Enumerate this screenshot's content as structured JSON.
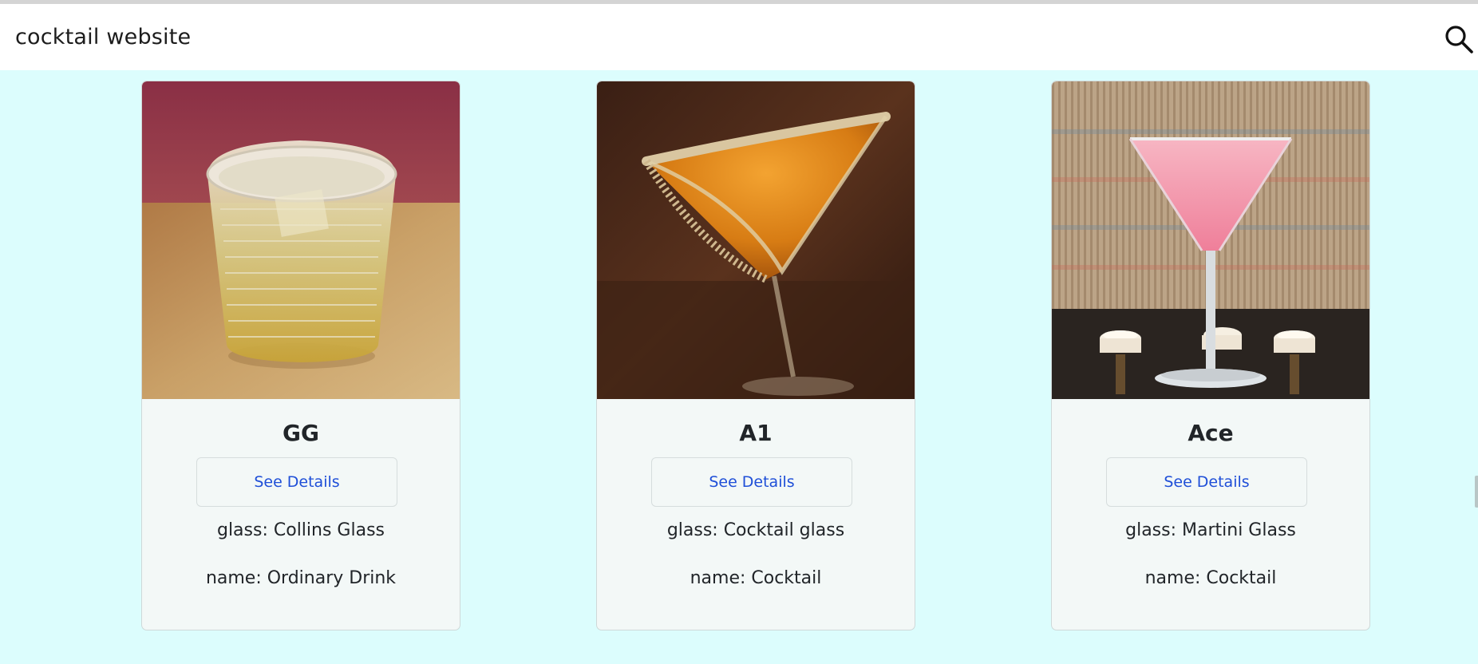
{
  "header": {
    "site_title": "cocktail website",
    "search_icon": "search-icon"
  },
  "colors": {
    "page_background": "#dcfdfd",
    "card_background": "#f3f8f7",
    "link_blue": "#1f4fd8"
  },
  "cards": [
    {
      "title": "GG",
      "button_label": "See Details",
      "glass": "glass: Collins Glass",
      "name": "name: Ordinary Drink",
      "image": "collins-glass-drink-photo"
    },
    {
      "title": "A1",
      "button_label": "See Details",
      "glass": "glass: Cocktail glass",
      "name": "name: Cocktail",
      "image": "orange-cocktail-photo"
    },
    {
      "title": "Ace",
      "button_label": "See Details",
      "glass": "glass: Martini Glass",
      "name": "name: Cocktail",
      "image": "pink-martini-photo"
    }
  ]
}
